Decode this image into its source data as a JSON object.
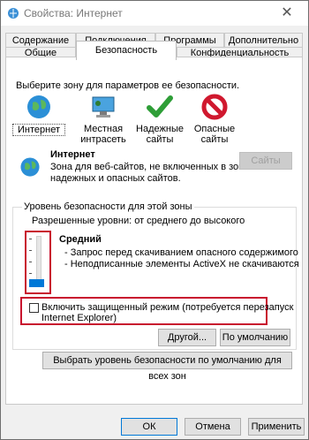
{
  "window": {
    "title": "Свойства: Интернет",
    "close": "✕"
  },
  "tabs": {
    "row1": [
      "Содержание",
      "Подключения",
      "Программы",
      "Дополнительно"
    ],
    "row2": [
      "Общие",
      "Безопасность",
      "Конфиденциальность"
    ],
    "active": "Безопасность"
  },
  "zones": {
    "prompt": "Выберите зону для параметров ее безопасности.",
    "items": [
      {
        "label1": "Интернет",
        "label2": "",
        "icon": "globe-icon"
      },
      {
        "label1": "Местная",
        "label2": "интрасеть",
        "icon": "intranet-icon"
      },
      {
        "label1": "Надежные",
        "label2": "сайты",
        "icon": "checkmark-icon"
      },
      {
        "label1": "Опасные",
        "label2": "сайты",
        "icon": "restricted-icon"
      }
    ]
  },
  "zone_info": {
    "name": "Интернет",
    "desc1": "Зона для веб-сайтов, не включенных в зоны",
    "desc2": "надежных и опасных сайтов.",
    "sites_button": "Сайты"
  },
  "security_level": {
    "group_title": "Уровень безопасности для этой зоны",
    "allowed": "Разрешенные уровни: от среднего до высокого",
    "level_name": "Средний",
    "bullet1": "- Запрос перед скачиванием опасного содержимого",
    "bullet2": "- Неподписанные элементы ActiveX не скачиваются",
    "slider_position": "Средний"
  },
  "protected_mode": {
    "label1": "Включить защищенный режим (потребуется перезапуск",
    "label2": "Internet Explorer)",
    "checked": false
  },
  "buttons": {
    "custom": "Другой...",
    "default_level": "По умолчанию",
    "reset_all": "Выбрать уровень безопасности по умолчанию для всех зон",
    "ok": "ОК",
    "cancel": "Отмена",
    "apply": "Применить"
  },
  "colors": {
    "highlight": "#c8102e",
    "accent": "#0078d7"
  }
}
